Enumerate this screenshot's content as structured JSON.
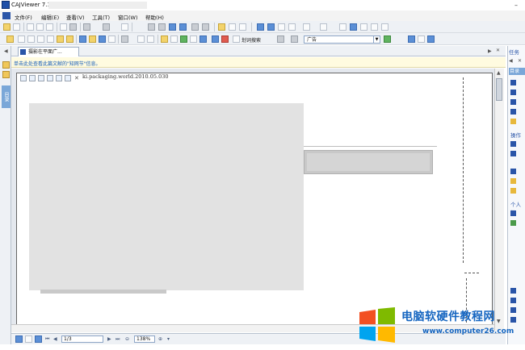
{
  "window": {
    "title": "CAJViewer 7.1",
    "minimize": "–"
  },
  "menu": {
    "items": [
      "文件(F)",
      "编辑(E)",
      "查看(V)",
      "工具(T)",
      "窗口(W)",
      "帮助(H)"
    ]
  },
  "toolbar": {
    "text_select_label": "划词搜索",
    "search_scope": "广告",
    "colors": {
      "toolbar_bg": "#eef1f5",
      "accent": "#2a55a8"
    }
  },
  "document": {
    "tab_title": "摄影在平面广...",
    "info_bar_text": "单击此处查看此篇文献的\"知网节\"信息。",
    "url_snippet": "ki.packaging.world.2010.05.030",
    "left_panel_label": "目录"
  },
  "status": {
    "page": "1/3",
    "zoom": "138%"
  },
  "right_panel": {
    "header": "任务",
    "section_tasks": "目录",
    "section_ops": "操作",
    "section_personal": "个人数"
  },
  "watermark": {
    "text": "电脑软硬件教程网",
    "url": "www.computer26.com"
  }
}
